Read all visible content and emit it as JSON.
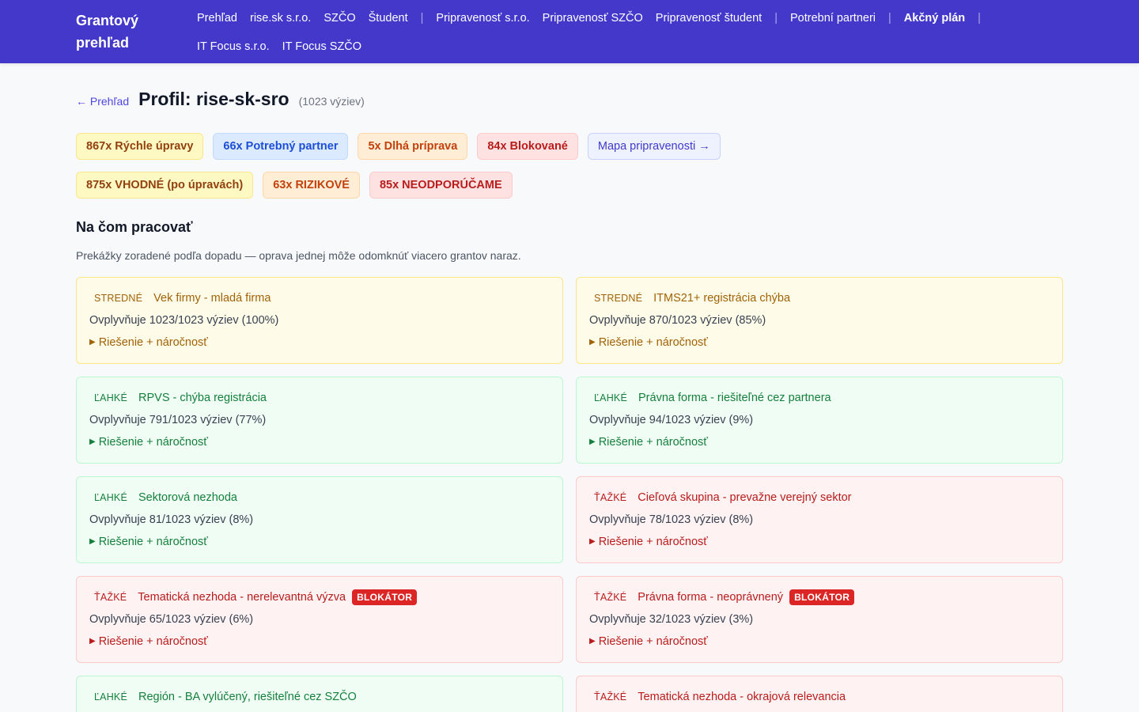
{
  "nav": {
    "brand": "Grantový prehľad",
    "links": [
      {
        "label": "Prehľad",
        "active": false
      },
      {
        "label": "rise.sk s.r.o.",
        "active": false
      },
      {
        "label": "SZČO",
        "active": false
      },
      {
        "label": "Študent",
        "active": false
      },
      {
        "label": "Pripravenosť s.r.o.",
        "active": false
      },
      {
        "label": "Pripravenosť SZČO",
        "active": false
      },
      {
        "label": "Pripravenosť študent",
        "active": false
      },
      {
        "label": "Potrební partneri",
        "active": false
      },
      {
        "label": "Akčný plán",
        "active": true
      },
      {
        "label": "IT Focus s.r.o.",
        "active": false
      },
      {
        "label": "IT Focus SZČO",
        "active": false
      }
    ],
    "separator": "|"
  },
  "header": {
    "back_label": "← Prehľad",
    "title": "Profil: rise-sk-sro",
    "count_note": "(1023 výziev)"
  },
  "summary_pills": [
    {
      "label": "867x Rýchle úpravy",
      "tone": "yellow"
    },
    {
      "label": "66x Potrebný partner",
      "tone": "blue"
    },
    {
      "label": "5x Dlhá príprava",
      "tone": "orange"
    },
    {
      "label": "84x Blokované",
      "tone": "red"
    },
    {
      "label": "Mapa pripravenosti →",
      "tone": "link"
    }
  ],
  "verdict_pills": [
    {
      "label": "875x VHODNÉ (po úpravách)",
      "tone": "yellow"
    },
    {
      "label": "63x RIZIKOVÉ",
      "tone": "orange"
    },
    {
      "label": "85x NEODPORÚČAME",
      "tone": "red"
    }
  ],
  "section": {
    "title": "Na čom pracovať",
    "description": "Prekážky zoradené podľa dopadu — oprava jednej môže odomknúť viacero grantov naraz."
  },
  "cards": [
    {
      "severity": "STREDNÉ",
      "tone": "yellow",
      "title": "Vek firmy - mladá firma",
      "badge": "",
      "impact": "Ovplyvňuje 1023/1023 výziev (100%)",
      "toggle": "Riešenie + náročnosť"
    },
    {
      "severity": "STREDNÉ",
      "tone": "yellow",
      "title": "ITMS21+ registrácia chýba",
      "badge": "",
      "impact": "Ovplyvňuje 870/1023 výziev (85%)",
      "toggle": "Riešenie + náročnosť"
    },
    {
      "severity": "ĽAHKÉ",
      "tone": "green",
      "title": "RPVS - chýba registrácia",
      "badge": "",
      "impact": "Ovplyvňuje 791/1023 výziev (77%)",
      "toggle": "Riešenie + náročnosť"
    },
    {
      "severity": "ĽAHKÉ",
      "tone": "green",
      "title": "Právna forma - riešiteľné cez partnera",
      "badge": "",
      "impact": "Ovplyvňuje 94/1023 výziev (9%)",
      "toggle": "Riešenie + náročnosť"
    },
    {
      "severity": "ĽAHKÉ",
      "tone": "green",
      "title": "Sektorová nezhoda",
      "badge": "",
      "impact": "Ovplyvňuje 81/1023 výziev (8%)",
      "toggle": "Riešenie + náročnosť"
    },
    {
      "severity": "ŤAŽKÉ",
      "tone": "red",
      "title": "Cieľová skupina - prevažne verejný sektor",
      "badge": "",
      "impact": "Ovplyvňuje 78/1023 výziev (8%)",
      "toggle": "Riešenie + náročnosť"
    },
    {
      "severity": "ŤAŽKÉ",
      "tone": "red",
      "title": "Tematická nezhoda - nerelevantná výzva",
      "badge": "BLOKÁTOR",
      "impact": "Ovplyvňuje 65/1023 výziev (6%)",
      "toggle": "Riešenie + náročnosť"
    },
    {
      "severity": "ŤAŽKÉ",
      "tone": "red",
      "title": "Právna forma - neoprávnený",
      "badge": "BLOKÁTOR",
      "impact": "Ovplyvňuje 32/1023 výziev (3%)",
      "toggle": "Riešenie + náročnosť"
    },
    {
      "severity": "ĽAHKÉ",
      "tone": "green",
      "title": "Región - BA vylúčený, riešiteľné cez SZČO",
      "badge": "",
      "impact": "",
      "toggle": ""
    },
    {
      "severity": "ŤAŽKÉ",
      "tone": "red",
      "title": "Tematická nezhoda - okrajová relevancia",
      "badge": "",
      "impact": "",
      "toggle": ""
    }
  ],
  "colors": {
    "nav_bg": "#4338ca",
    "page_bg": "#f8f9fb",
    "blocker_badge": "#dc2626"
  },
  "icons": {
    "back": "arrow-left-icon",
    "map_link": "arrow-right-icon",
    "toggle": "triangle-right-icon"
  }
}
